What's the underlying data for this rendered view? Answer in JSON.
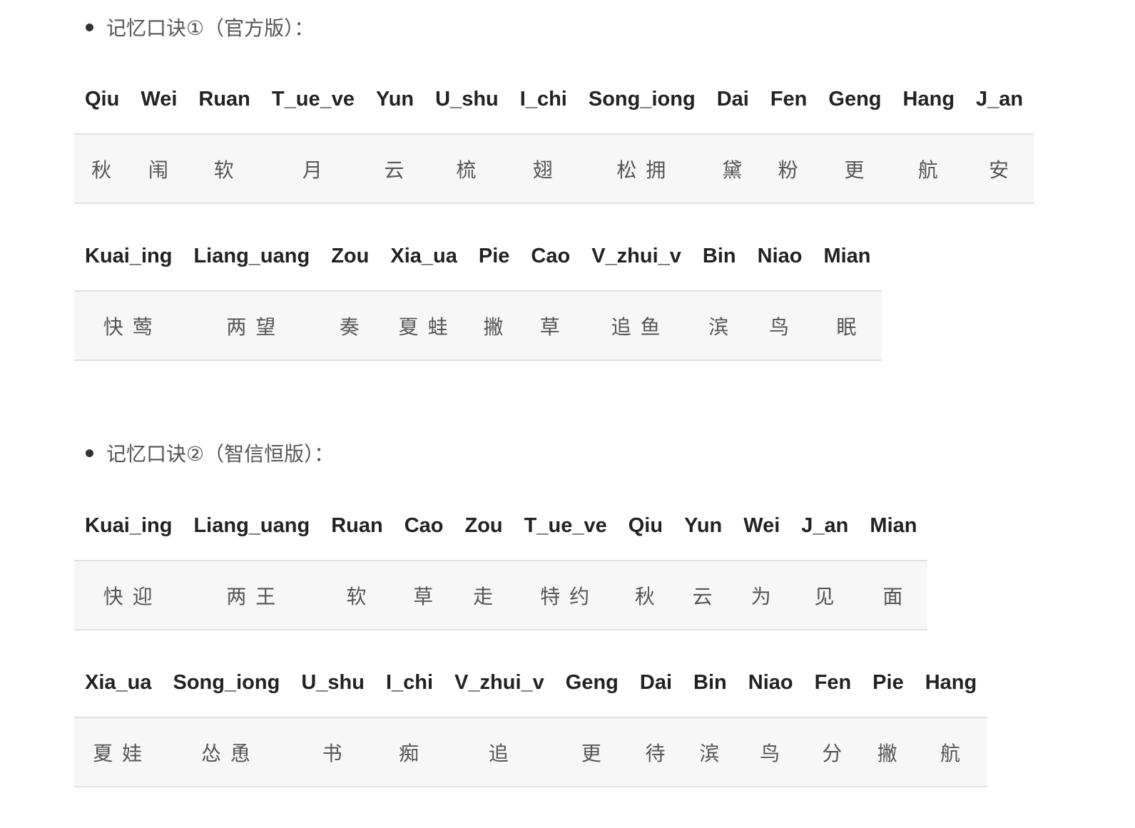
{
  "section1": {
    "title": "记忆口诀①（官方版）：",
    "table1": {
      "headers": [
        "Qiu",
        "Wei",
        "Ruan",
        "T_ue_ve",
        "Yun",
        "U_shu",
        "I_chi",
        "Song_iong",
        "Dai",
        "Fen",
        "Geng",
        "Hang",
        "J_an"
      ],
      "cells": [
        "秋",
        "闱",
        "软",
        "月",
        "云",
        "梳",
        "翅",
        "松 拥",
        "黛",
        "粉",
        "更",
        "航",
        "安"
      ]
    },
    "table2": {
      "headers": [
        "Kuai_ing",
        "Liang_uang",
        "Zou",
        "Xia_ua",
        "Pie",
        "Cao",
        "V_zhui_v",
        "Bin",
        "Niao",
        "Mian"
      ],
      "cells": [
        "快 莺",
        "两 望",
        "奏",
        "夏 蛙",
        "撇",
        "草",
        "追 鱼",
        "滨",
        "鸟",
        "眠"
      ]
    }
  },
  "section2": {
    "title": "记忆口诀②（智信恒版）：",
    "table1": {
      "headers": [
        "Kuai_ing",
        "Liang_uang",
        "Ruan",
        "Cao",
        "Zou",
        "T_ue_ve",
        "Qiu",
        "Yun",
        "Wei",
        "J_an",
        "Mian"
      ],
      "cells": [
        "快 迎",
        "两 王",
        "软",
        "草",
        "走",
        "特 约",
        "秋",
        "云",
        "为",
        "见",
        "面"
      ]
    },
    "table2": {
      "headers": [
        "Xia_ua",
        "Song_iong",
        "U_shu",
        "I_chi",
        "V_zhui_v",
        "Geng",
        "Dai",
        "Bin",
        "Niao",
        "Fen",
        "Pie",
        "Hang"
      ],
      "cells": [
        "夏 娃",
        "怂 恿",
        "书",
        "痴",
        "追",
        "更",
        "待",
        "滨",
        "鸟",
        "分",
        "撇",
        "航"
      ]
    }
  }
}
